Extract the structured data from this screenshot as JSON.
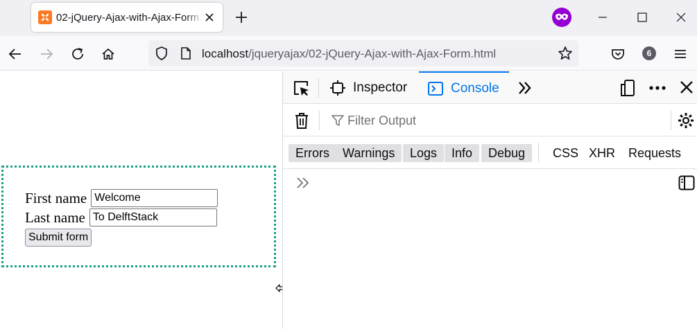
{
  "browser": {
    "tab": {
      "title": "02-jQuery-Ajax-with-Ajax-Form.html"
    },
    "url": {
      "host": "localhost",
      "path": "/jqueryajax/02-jQuery-Ajax-with-Ajax-Form.html"
    },
    "account_badge": "6"
  },
  "page": {
    "form": {
      "first_name_label": "First name",
      "first_name_value": "Welcome",
      "last_name_label": "Last name",
      "last_name_value": "To DelftStack",
      "submit_label": "Submit form"
    }
  },
  "devtools": {
    "tabs": {
      "inspector": "Inspector",
      "console": "Console"
    },
    "filter_placeholder": "Filter Output",
    "levels": [
      "Errors",
      "Warnings",
      "Logs",
      "Info",
      "Debug"
    ],
    "requests": [
      "CSS",
      "XHR",
      "Requests"
    ]
  },
  "colors": {
    "form_border": "#16a085",
    "devtools_accent": "#0074e8",
    "tab_favicon": "#fb7a24",
    "extension": "#9400d3"
  }
}
